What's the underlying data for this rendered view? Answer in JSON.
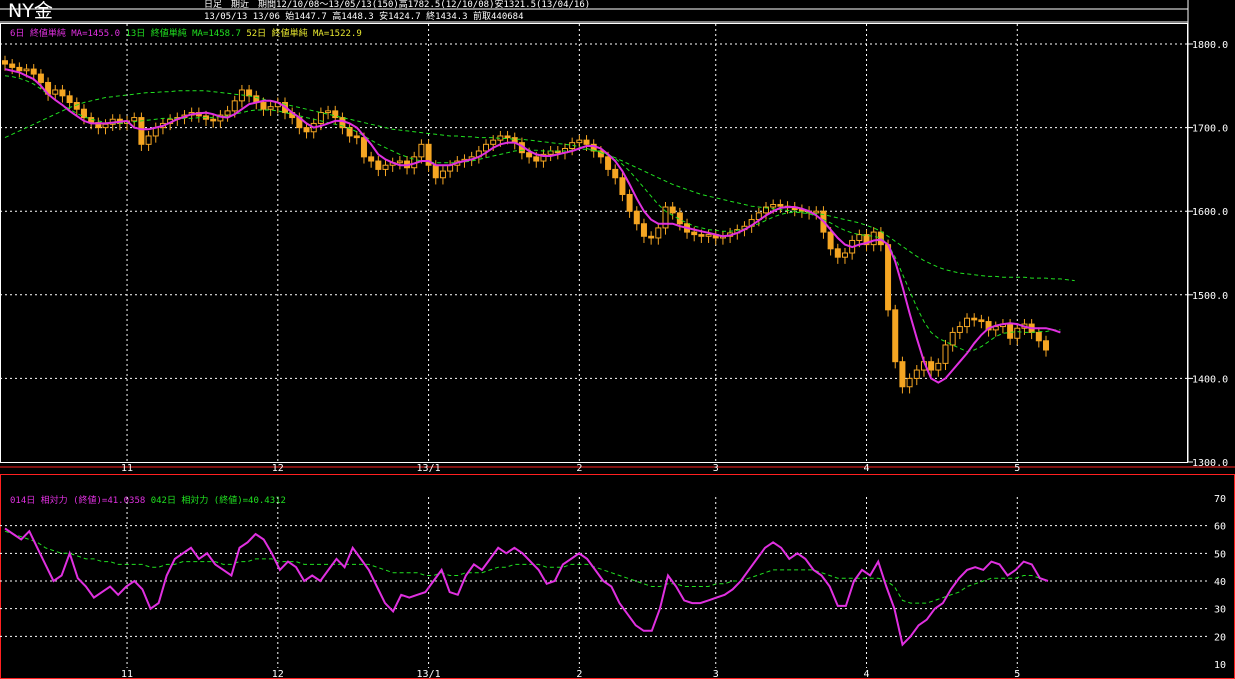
{
  "header": {
    "title": "NY金",
    "info_line1": "日足　期近　期間12/10/08〜13/05/13(150)高1782.5(12/10/08)安1321.5(13/04/16)",
    "info_line2": "13/05/13 13/06 始1447.7 高1448.3 安1424.7 終1434.3 前取440684"
  },
  "legends": {
    "price": [
      {
        "text": "6日 終値単純 MA=1455.0",
        "color": "#e030e0"
      },
      {
        "text": "13日 終値単純 MA=1458.7",
        "color": "#20e020"
      },
      {
        "text": "52日 終値単純 MA=1522.9",
        "color": "#e8e830"
      }
    ],
    "rsi": [
      {
        "text": "014日 相対力 (終値)=41.0358",
        "color": "#e030e0"
      },
      {
        "text": "042日 相対力 (終値)=40.4312",
        "color": "#20e020"
      }
    ]
  },
  "colors": {
    "background": "#000000",
    "candle": "#f5a623",
    "ma6": "#e030e0",
    "ma13": "#20e020",
    "ma52": "#e8e830",
    "rsi14": "#e030e0",
    "rsi42": "#20e020",
    "grid": "#ffffff",
    "frame": "#ff2020"
  },
  "chart_data": [
    {
      "type": "candlestick",
      "title": "NY金",
      "x_ticks": [
        {
          "label": "11",
          "index": 17
        },
        {
          "label": "12",
          "index": 38
        },
        {
          "label": "13/1",
          "index": 59
        },
        {
          "label": "2",
          "index": 80
        },
        {
          "label": "3",
          "index": 99
        },
        {
          "label": "4",
          "index": 120
        },
        {
          "label": "5",
          "index": 141
        }
      ],
      "y_ticks": [
        1300,
        1400,
        1500,
        1600,
        1700,
        1800
      ],
      "ylim": [
        1300,
        1815
      ],
      "candles_close": [
        1776,
        1772,
        1768,
        1770,
        1764,
        1754,
        1740,
        1745,
        1738,
        1730,
        1722,
        1712,
        1706,
        1700,
        1704,
        1710,
        1705,
        1708,
        1712,
        1680,
        1690,
        1700,
        1705,
        1710,
        1712,
        1715,
        1718,
        1714,
        1710,
        1708,
        1715,
        1720,
        1732,
        1745,
        1738,
        1730,
        1722,
        1725,
        1730,
        1718,
        1712,
        1700,
        1695,
        1705,
        1718,
        1720,
        1712,
        1700,
        1690,
        1688,
        1665,
        1660,
        1650,
        1655,
        1658,
        1660,
        1652,
        1665,
        1680,
        1655,
        1640,
        1648,
        1655,
        1660,
        1662,
        1665,
        1672,
        1680,
        1685,
        1690,
        1688,
        1682,
        1670,
        1665,
        1660,
        1668,
        1672,
        1670,
        1675,
        1682,
        1685,
        1680,
        1672,
        1665,
        1650,
        1640,
        1620,
        1600,
        1585,
        1570,
        1568,
        1580,
        1605,
        1598,
        1585,
        1575,
        1572,
        1570,
        1572,
        1568,
        1570,
        1574,
        1578,
        1582,
        1590,
        1598,
        1605,
        1608,
        1606,
        1605,
        1602,
        1600,
        1598,
        1600,
        1575,
        1555,
        1545,
        1550,
        1565,
        1572,
        1560,
        1575,
        1560,
        1482,
        1420,
        1390,
        1400,
        1410,
        1420,
        1410,
        1418,
        1440,
        1455,
        1462,
        1472,
        1470,
        1468,
        1458,
        1462,
        1465,
        1448,
        1460,
        1465,
        1455,
        1445,
        1434
      ],
      "ma6": [
        1770,
        1768,
        1766,
        1762,
        1758,
        1750,
        1740,
        1733,
        1727,
        1720,
        1714,
        1708,
        1705,
        1705,
        1705,
        1706,
        1707,
        1708,
        1700,
        1698,
        1698,
        1700,
        1702,
        1706,
        1710,
        1713,
        1716,
        1717,
        1718,
        1716,
        1713,
        1712,
        1716,
        1722,
        1728,
        1730,
        1732,
        1732,
        1730,
        1725,
        1718,
        1712,
        1705,
        1700,
        1702,
        1705,
        1708,
        1708,
        1705,
        1700,
        1690,
        1680,
        1668,
        1662,
        1658,
        1655,
        1655,
        1657,
        1660,
        1660,
        1655,
        1655,
        1655,
        1658,
        1660,
        1662,
        1665,
        1670,
        1676,
        1680,
        1682,
        1682,
        1678,
        1672,
        1668,
        1666,
        1666,
        1668,
        1670,
        1672,
        1675,
        1678,
        1678,
        1675,
        1668,
        1660,
        1648,
        1632,
        1615,
        1600,
        1590,
        1585,
        1585,
        1585,
        1582,
        1580,
        1578,
        1576,
        1574,
        1572,
        1570,
        1571,
        1574,
        1578,
        1583,
        1589,
        1595,
        1600,
        1604,
        1605,
        1605,
        1603,
        1600,
        1595,
        1588,
        1578,
        1568,
        1560,
        1557,
        1560,
        1562,
        1565,
        1566,
        1560,
        1540,
        1510,
        1478,
        1448,
        1420,
        1400,
        1395,
        1400,
        1410,
        1420,
        1430,
        1442,
        1452,
        1460,
        1463,
        1465,
        1466,
        1465,
        1462,
        1460,
        1460,
        1460,
        1458,
        1455
      ],
      "ma13": [
        1762,
        1761,
        1759,
        1756,
        1752,
        1746,
        1740,
        1733,
        1727,
        1722,
        1717,
        1713,
        1710,
        1708,
        1706,
        1705,
        1705,
        1706,
        1707,
        1708,
        1709,
        1710,
        1711,
        1711,
        1711,
        1711,
        1711,
        1712,
        1712,
        1712,
        1713,
        1714,
        1716,
        1718,
        1720,
        1721,
        1721,
        1721,
        1720,
        1718,
        1716,
        1714,
        1712,
        1710,
        1708,
        1706,
        1704,
        1702,
        1699,
        1695,
        1690,
        1685,
        1680,
        1676,
        1672,
        1668,
        1665,
        1662,
        1660,
        1659,
        1658,
        1658,
        1658,
        1658,
        1659,
        1660,
        1662,
        1664,
        1666,
        1668,
        1670,
        1672,
        1673,
        1673,
        1673,
        1672,
        1672,
        1672,
        1672,
        1673,
        1674,
        1674,
        1673,
        1671,
        1668,
        1663,
        1656,
        1648,
        1638,
        1628,
        1618,
        1608,
        1600,
        1595,
        1590,
        1586,
        1582,
        1580,
        1578,
        1577,
        1576,
        1576,
        1577,
        1579,
        1582,
        1585,
        1589,
        1593,
        1596,
        1598,
        1599,
        1598,
        1597,
        1594,
        1590,
        1586,
        1581,
        1577,
        1574,
        1572,
        1571,
        1570,
        1568,
        1560,
        1545,
        1525,
        1505,
        1485,
        1468,
        1455,
        1448,
        1444,
        1440,
        1436,
        1432,
        1434,
        1438,
        1444,
        1450,
        1454,
        1455,
        1456,
        1455,
        1455,
        1456,
        1456,
        1458,
        1458
      ],
      "ma52": [
        1688,
        1692,
        1696,
        1700,
        1704,
        1708,
        1712,
        1716,
        1720,
        1724,
        1727,
        1730,
        1732,
        1734,
        1736,
        1737,
        1738,
        1739,
        1740,
        1741,
        1742,
        1742,
        1743,
        1743,
        1744,
        1744,
        1744,
        1744,
        1744,
        1743,
        1742,
        1741,
        1740,
        1739,
        1738,
        1736,
        1734,
        1732,
        1730,
        1728,
        1726,
        1724,
        1722,
        1720,
        1718,
        1716,
        1714,
        1712,
        1710,
        1708,
        1706,
        1704,
        1702,
        1700,
        1698,
        1697,
        1696,
        1695,
        1694,
        1693,
        1692,
        1691,
        1690,
        1690,
        1689,
        1689,
        1688,
        1688,
        1688,
        1687,
        1687,
        1686,
        1686,
        1685,
        1684,
        1683,
        1682,
        1681,
        1680,
        1679,
        1677,
        1675,
        1673,
        1670,
        1667,
        1664,
        1660,
        1656,
        1652,
        1648,
        1644,
        1640,
        1636,
        1632,
        1629,
        1626,
        1623,
        1620,
        1618,
        1616,
        1614,
        1612,
        1610,
        1608,
        1606,
        1605,
        1604,
        1603,
        1602,
        1601,
        1600,
        1599,
        1598,
        1597,
        1596,
        1594,
        1592,
        1590,
        1588,
        1586,
        1583,
        1580,
        1576,
        1570,
        1564,
        1558,
        1552,
        1546,
        1541,
        1537,
        1533,
        1530,
        1528,
        1526,
        1525,
        1524,
        1523,
        1522,
        1522,
        1521,
        1521,
        1521,
        1521,
        1520,
        1520,
        1520,
        1519,
        1519,
        1518,
        1517
      ]
    },
    {
      "type": "line",
      "title": "",
      "x_ticks": [
        "11",
        "12",
        "13/1",
        "2",
        "3",
        "4",
        "5"
      ],
      "y_ticks": [
        10,
        20,
        30,
        40,
        50,
        60,
        70
      ],
      "ylim": [
        10,
        70
      ],
      "series": [
        {
          "name": "014日 相対力 (終値)",
          "values": [
            59,
            57,
            55,
            58,
            52,
            46,
            40,
            42,
            50,
            41,
            38,
            34,
            36,
            38,
            35,
            38,
            40,
            37,
            30,
            32,
            42,
            48,
            50,
            52,
            48,
            50,
            46,
            44,
            42,
            52,
            54,
            57,
            55,
            50,
            44,
            47,
            45,
            40,
            42,
            40,
            44,
            48,
            45,
            52,
            48,
            44,
            38,
            32,
            29,
            35,
            34,
            35,
            36,
            40,
            44,
            36,
            35,
            42,
            46,
            44,
            48,
            52,
            50,
            52,
            50,
            47,
            44,
            39,
            40,
            46,
            48,
            50,
            48,
            44,
            40,
            38,
            32,
            28,
            24,
            22,
            22,
            30,
            42,
            38,
            33,
            32,
            32,
            33,
            34,
            35,
            37,
            40,
            44,
            48,
            52,
            54,
            52,
            48,
            50,
            48,
            44,
            42,
            38,
            31,
            31,
            40,
            44,
            42,
            47,
            38,
            30,
            17,
            20,
            24,
            26,
            30,
            32,
            37,
            41,
            44,
            45,
            44,
            47,
            46,
            42,
            44,
            47,
            46,
            41,
            40
          ]
        },
        {
          "name": "042日 相対力 (終値)",
          "values": [
            58,
            57,
            56,
            55,
            54,
            52,
            51,
            50,
            50,
            49,
            48,
            48,
            47,
            47,
            46,
            46,
            46,
            46,
            45,
            45,
            46,
            46,
            47,
            47,
            47,
            47,
            47,
            46,
            46,
            47,
            47,
            48,
            48,
            48,
            47,
            47,
            47,
            46,
            46,
            46,
            46,
            46,
            46,
            46,
            46,
            46,
            45,
            44,
            43,
            43,
            43,
            43,
            42,
            42,
            43,
            42,
            42,
            43,
            43,
            43,
            44,
            45,
            45,
            46,
            46,
            46,
            46,
            45,
            45,
            45,
            46,
            46,
            46,
            45,
            44,
            43,
            42,
            41,
            40,
            39,
            38,
            38,
            39,
            39,
            38,
            38,
            38,
            38,
            39,
            39,
            40,
            40,
            41,
            42,
            43,
            44,
            44,
            44,
            44,
            44,
            44,
            43,
            42,
            41,
            41,
            41,
            41,
            41,
            41,
            40,
            38,
            33,
            32,
            32,
            32,
            33,
            34,
            35,
            36,
            38,
            39,
            40,
            41,
            41,
            41,
            41,
            42,
            42,
            41,
            40
          ]
        }
      ]
    }
  ]
}
